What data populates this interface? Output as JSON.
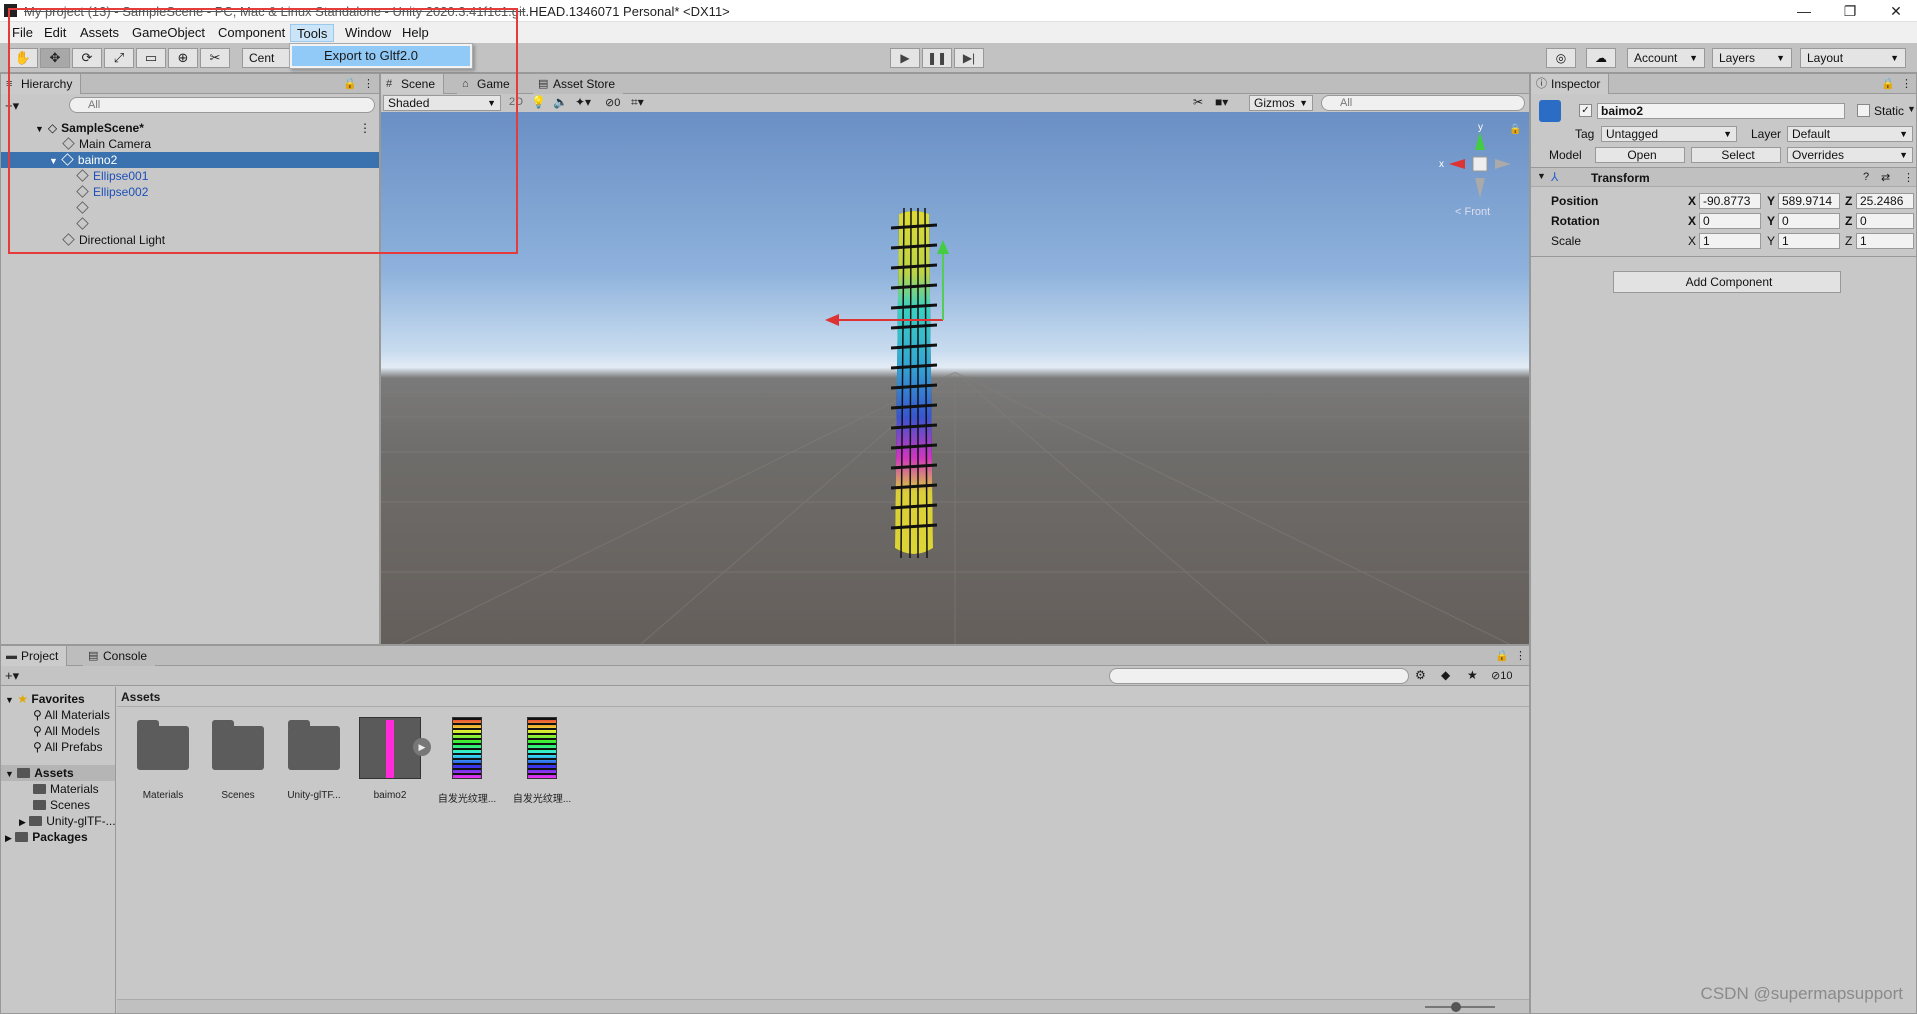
{
  "window": {
    "title_strike": "My project (13) - SampleScene - PC, Mac & Linux Standalone - Unity 2020.3.41f1c1.git",
    "title_rest": ".HEAD.1346071 Personal* <DX11>",
    "minimize": "—",
    "restore": "❐",
    "close": "✕"
  },
  "menu": [
    "File",
    "Edit",
    "Assets",
    "GameObject",
    "Component",
    "Tools",
    "Window",
    "Help"
  ],
  "tools_menu": {
    "export": "Export to Gltf2.0"
  },
  "toolbar": {
    "pivot_label": "Cent",
    "account": "Account",
    "layers": "Layers",
    "layout": "Layout"
  },
  "hierarchy": {
    "tab": "Hierarchy",
    "search_placeholder": "All",
    "scene": "SampleScene*",
    "items": [
      {
        "label": "Main Camera",
        "indent": 1
      },
      {
        "label": "baimo2",
        "indent": 1
      },
      {
        "label": "Ellipse001",
        "indent": 2
      },
      {
        "label": "Ellipse002",
        "indent": 2
      },
      {
        "label": "",
        "indent": 2
      },
      {
        "label": "",
        "indent": 2
      },
      {
        "label": "Directional Light",
        "indent": 1
      }
    ]
  },
  "scene": {
    "tabs": [
      "Scene",
      "Game",
      "Asset Store"
    ],
    "shading": "Shaded",
    "mode_2d": "2D",
    "hidden_count": "0",
    "gizmos": "Gizmos",
    "search_placeholder": "All",
    "gizmo_y": "y",
    "gizmo_x": "x",
    "gizmo_front": "< Front"
  },
  "inspector": {
    "tab": "Inspector",
    "name": "baimo2",
    "static": "Static",
    "tag_label": "Tag",
    "tag": "Untagged",
    "layer_label": "Layer",
    "layer": "Default",
    "model_label": "Model",
    "open": "Open",
    "select": "Select",
    "overrides": "Overrides",
    "transform": "Transform",
    "position_label": "Position",
    "rotation_label": "Rotation",
    "scale_label": "Scale",
    "position": {
      "x": "-90.8773",
      "y": "589.9714",
      "z": "25.2486"
    },
    "rotation": {
      "x": "0",
      "y": "0",
      "z": "0"
    },
    "scale": {
      "x": "1",
      "y": "1",
      "z": "1"
    },
    "add_component": "Add Component"
  },
  "project": {
    "tabs": [
      "Project",
      "Console"
    ],
    "hidden_count": "10",
    "breadcrumb": "Assets",
    "favorites": "Favorites",
    "fav_items": [
      "All Materials",
      "All Models",
      "All Prefabs"
    ],
    "assets_root": "Assets",
    "asset_folders": [
      "Materials",
      "Scenes",
      "Unity-glTF-..."
    ],
    "packages": "Packages",
    "tiles": [
      "Materials",
      "Scenes",
      "Unity-glTF...",
      "baimo2",
      "自发光纹理...",
      "自发光纹理..."
    ]
  },
  "watermark": "CSDN @supermapsupport",
  "colors": {
    "selection": "#3a72b0",
    "highlight_box": "#e53b3b",
    "menu_hover": "#91c9f7"
  }
}
